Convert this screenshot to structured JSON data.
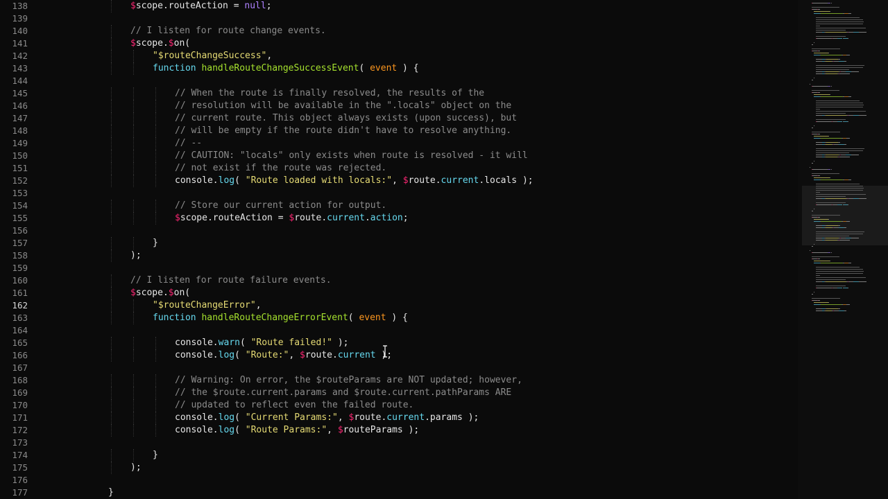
{
  "editor": {
    "active_line": "162",
    "lines": [
      {
        "num": "138",
        "indent": 4,
        "tokens": [
          [
            "sigil",
            "$"
          ],
          [
            "plain",
            "scope.routeAction = "
          ],
          [
            "null",
            "null"
          ],
          [
            "plain",
            ";"
          ]
        ]
      },
      {
        "num": "139",
        "indent": 0,
        "tokens": []
      },
      {
        "num": "140",
        "indent": 4,
        "tokens": [
          [
            "comment",
            "// I listen for route change events."
          ]
        ]
      },
      {
        "num": "141",
        "indent": 4,
        "tokens": [
          [
            "sigil",
            "$"
          ],
          [
            "plain",
            "scope."
          ],
          [
            "sigil",
            "$"
          ],
          [
            "plain",
            "on("
          ]
        ]
      },
      {
        "num": "142",
        "indent": 5,
        "tokens": [
          [
            "string",
            "\"$routeChangeSuccess\""
          ],
          [
            "plain",
            ","
          ]
        ]
      },
      {
        "num": "143",
        "indent": 5,
        "tokens": [
          [
            "keyword",
            "function"
          ],
          [
            "plain",
            " "
          ],
          [
            "func",
            "handleRouteChangeSuccessEvent"
          ],
          [
            "plain",
            "( "
          ],
          [
            "param",
            "event"
          ],
          [
            "plain",
            " ) {"
          ]
        ]
      },
      {
        "num": "144",
        "indent": 0,
        "tokens": []
      },
      {
        "num": "145",
        "indent": 6,
        "tokens": [
          [
            "comment",
            "// When the route is finally resolved, the results of the"
          ]
        ]
      },
      {
        "num": "146",
        "indent": 6,
        "tokens": [
          [
            "comment",
            "// resolution will be available in the \".locals\" object on the"
          ]
        ]
      },
      {
        "num": "147",
        "indent": 6,
        "tokens": [
          [
            "comment",
            "// current route. This object always exists (upon success), but"
          ]
        ]
      },
      {
        "num": "148",
        "indent": 6,
        "tokens": [
          [
            "comment",
            "// will be empty if the route didn't have to resolve anything."
          ]
        ]
      },
      {
        "num": "149",
        "indent": 6,
        "tokens": [
          [
            "comment",
            "// --"
          ]
        ]
      },
      {
        "num": "150",
        "indent": 6,
        "tokens": [
          [
            "comment",
            "// CAUTION: \"locals\" only exists when route is resolved - it will"
          ]
        ]
      },
      {
        "num": "151",
        "indent": 6,
        "tokens": [
          [
            "comment",
            "// not exist if the route was rejected."
          ]
        ]
      },
      {
        "num": "152",
        "indent": 6,
        "tokens": [
          [
            "plain",
            "console."
          ],
          [
            "method",
            "log"
          ],
          [
            "plain",
            "( "
          ],
          [
            "string",
            "\"Route loaded with locals:\""
          ],
          [
            "plain",
            ", "
          ],
          [
            "sigil",
            "$"
          ],
          [
            "plain",
            "route."
          ],
          [
            "method",
            "current"
          ],
          [
            "plain",
            ".locals );"
          ]
        ]
      },
      {
        "num": "153",
        "indent": 0,
        "tokens": []
      },
      {
        "num": "154",
        "indent": 6,
        "tokens": [
          [
            "comment",
            "// Store our current action for output."
          ]
        ]
      },
      {
        "num": "155",
        "indent": 6,
        "tokens": [
          [
            "sigil",
            "$"
          ],
          [
            "plain",
            "scope.routeAction = "
          ],
          [
            "sigil",
            "$"
          ],
          [
            "plain",
            "route."
          ],
          [
            "method",
            "current"
          ],
          [
            "plain",
            "."
          ],
          [
            "method",
            "action"
          ],
          [
            "plain",
            ";"
          ]
        ]
      },
      {
        "num": "156",
        "indent": 0,
        "tokens": []
      },
      {
        "num": "157",
        "indent": 5,
        "tokens": [
          [
            "plain",
            "}"
          ]
        ]
      },
      {
        "num": "158",
        "indent": 4,
        "tokens": [
          [
            "plain",
            ");"
          ]
        ]
      },
      {
        "num": "159",
        "indent": 0,
        "tokens": []
      },
      {
        "num": "160",
        "indent": 4,
        "tokens": [
          [
            "comment",
            "// I listen for route failure events."
          ]
        ]
      },
      {
        "num": "161",
        "indent": 4,
        "tokens": [
          [
            "sigil",
            "$"
          ],
          [
            "plain",
            "scope."
          ],
          [
            "sigil",
            "$"
          ],
          [
            "plain",
            "on("
          ]
        ]
      },
      {
        "num": "162",
        "indent": 5,
        "tokens": [
          [
            "string",
            "\"$routeChangeError\""
          ],
          [
            "plain",
            ","
          ]
        ]
      },
      {
        "num": "163",
        "indent": 5,
        "tokens": [
          [
            "keyword",
            "function"
          ],
          [
            "plain",
            " "
          ],
          [
            "func",
            "handleRouteChangeErrorEvent"
          ],
          [
            "plain",
            "( "
          ],
          [
            "param",
            "event"
          ],
          [
            "plain",
            " ) {"
          ]
        ]
      },
      {
        "num": "164",
        "indent": 0,
        "tokens": []
      },
      {
        "num": "165",
        "indent": 6,
        "tokens": [
          [
            "plain",
            "console."
          ],
          [
            "method",
            "warn"
          ],
          [
            "plain",
            "( "
          ],
          [
            "string",
            "\"Route failed!\""
          ],
          [
            "plain",
            " );"
          ]
        ]
      },
      {
        "num": "166",
        "indent": 6,
        "tokens": [
          [
            "plain",
            "console."
          ],
          [
            "method",
            "log"
          ],
          [
            "plain",
            "( "
          ],
          [
            "string",
            "\"Route:\""
          ],
          [
            "plain",
            ", "
          ],
          [
            "sigil",
            "$"
          ],
          [
            "plain",
            "route."
          ],
          [
            "method",
            "current"
          ],
          [
            "plain",
            " );"
          ]
        ]
      },
      {
        "num": "167",
        "indent": 0,
        "tokens": []
      },
      {
        "num": "168",
        "indent": 6,
        "tokens": [
          [
            "comment",
            "// Warning: On error, the $routeParams are NOT updated; however,"
          ]
        ]
      },
      {
        "num": "169",
        "indent": 6,
        "tokens": [
          [
            "comment",
            "// the $route.current.params and $route.current.pathParams ARE"
          ]
        ]
      },
      {
        "num": "170",
        "indent": 6,
        "tokens": [
          [
            "comment",
            "// updated to reflect even the failed route."
          ]
        ]
      },
      {
        "num": "171",
        "indent": 6,
        "tokens": [
          [
            "plain",
            "console."
          ],
          [
            "method",
            "log"
          ],
          [
            "plain",
            "( "
          ],
          [
            "string",
            "\"Current Params:\""
          ],
          [
            "plain",
            ", "
          ],
          [
            "sigil",
            "$"
          ],
          [
            "plain",
            "route."
          ],
          [
            "method",
            "current"
          ],
          [
            "plain",
            ".params );"
          ]
        ]
      },
      {
        "num": "172",
        "indent": 6,
        "tokens": [
          [
            "plain",
            "console."
          ],
          [
            "method",
            "log"
          ],
          [
            "plain",
            "( "
          ],
          [
            "string",
            "\"Route Params:\""
          ],
          [
            "plain",
            ", "
          ],
          [
            "sigil",
            "$"
          ],
          [
            "plain",
            "routeParams );"
          ]
        ]
      },
      {
        "num": "173",
        "indent": 0,
        "tokens": []
      },
      {
        "num": "174",
        "indent": 5,
        "tokens": [
          [
            "plain",
            "}"
          ]
        ]
      },
      {
        "num": "175",
        "indent": 4,
        "tokens": [
          [
            "plain",
            ");"
          ]
        ]
      },
      {
        "num": "176",
        "indent": 0,
        "tokens": []
      },
      {
        "num": "177",
        "indent": 3,
        "tokens": [
          [
            "plain",
            "}"
          ]
        ]
      }
    ]
  },
  "theme": {
    "background": "#0b0b0b",
    "comment": "#8c8c8c",
    "string": "#e6db74",
    "keyword": "#66d9ef",
    "function": "#a6e22e",
    "param": "#fd971f",
    "sigil": "#f92672"
  },
  "icons": {
    "cursor": "text-cursor-icon"
  }
}
